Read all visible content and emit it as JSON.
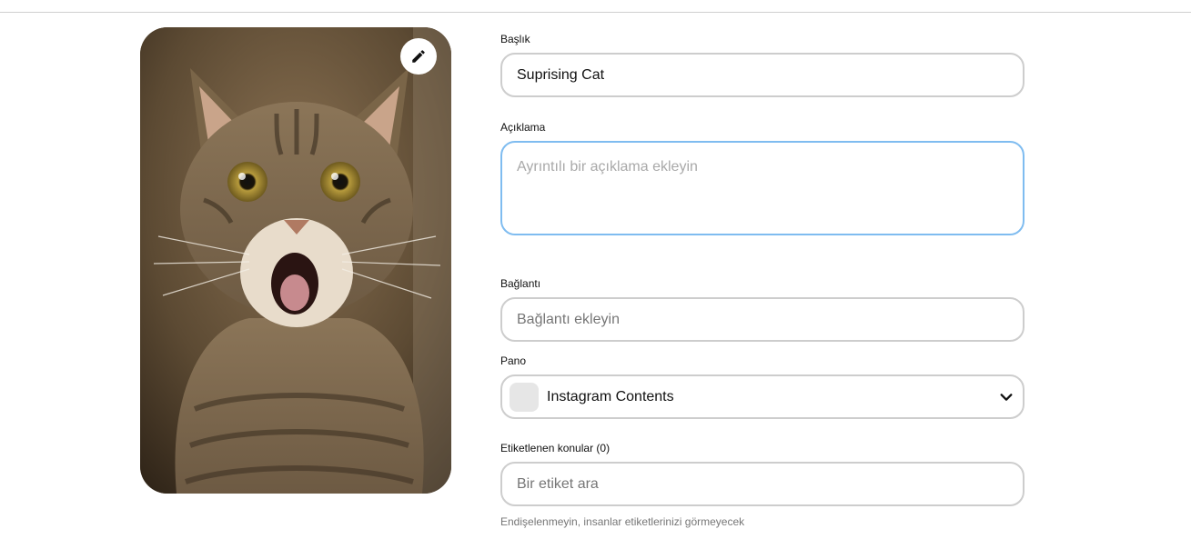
{
  "image": {
    "alt": "Suprising Cat",
    "edit_icon": "pencil-icon"
  },
  "form": {
    "title": {
      "label": "Başlık",
      "value": "Suprising Cat"
    },
    "description": {
      "label": "Açıklama",
      "placeholder": "Ayrıntılı bir açıklama ekleyin"
    },
    "link": {
      "label": "Bağlantı",
      "placeholder": "Bağlantı ekleyin"
    },
    "board": {
      "label": "Pano",
      "selected": "Instagram Contents",
      "icon": "chevron-down-icon"
    },
    "tags": {
      "label": "Etiketlenen konular (0)",
      "placeholder": "Bir etiket ara",
      "helper": "Endişelenmeyin, insanlar etiketlerinizi görmeyecek"
    }
  },
  "colors": {
    "focus_border": "#7fbcf0",
    "input_border": "#cdcdcd",
    "muted_text": "#767676"
  }
}
